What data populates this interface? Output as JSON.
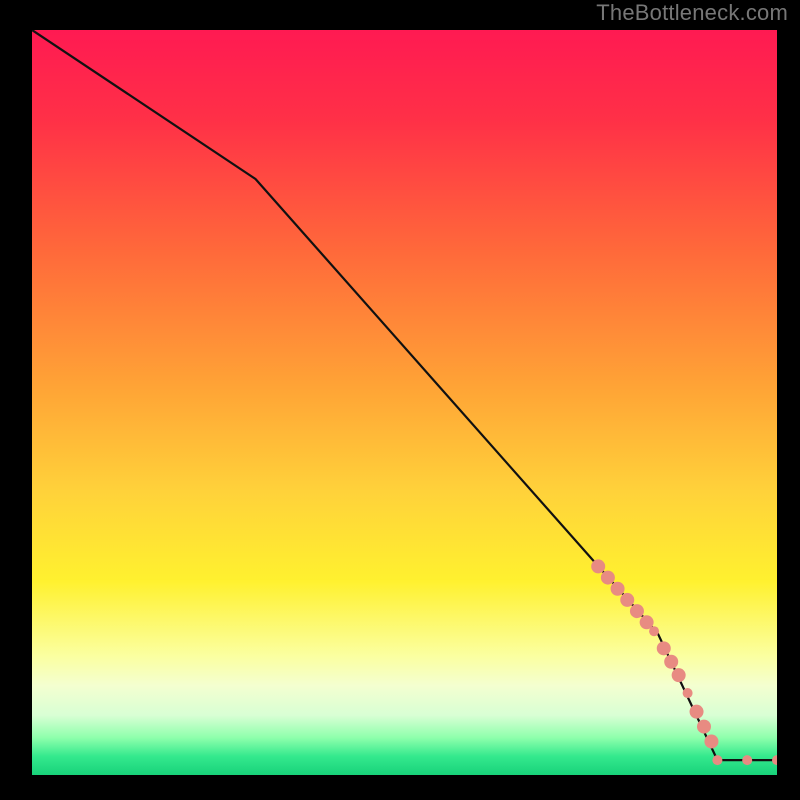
{
  "watermark": "TheBottleneck.com",
  "chart_data": {
    "type": "line",
    "title": "",
    "xlabel": "",
    "ylabel": "",
    "xlim": [
      0,
      100
    ],
    "ylim": [
      0,
      100
    ],
    "series": [
      {
        "name": "curve",
        "style": "line",
        "color": "#111111",
        "x": [
          0,
          30,
          84,
          92,
          100
        ],
        "y": [
          100,
          80,
          19,
          2,
          2
        ]
      },
      {
        "name": "markers",
        "style": "points",
        "color": "#e88b82",
        "radius_large": 7,
        "radius_small": 5,
        "points": [
          {
            "x": 76.0,
            "y": 28.0,
            "r": "large"
          },
          {
            "x": 77.3,
            "y": 26.5,
            "r": "large"
          },
          {
            "x": 78.6,
            "y": 25.0,
            "r": "large"
          },
          {
            "x": 79.9,
            "y": 23.5,
            "r": "large"
          },
          {
            "x": 81.2,
            "y": 22.0,
            "r": "large"
          },
          {
            "x": 82.5,
            "y": 20.5,
            "r": "large"
          },
          {
            "x": 83.5,
            "y": 19.3,
            "r": "small"
          },
          {
            "x": 84.8,
            "y": 17.0,
            "r": "large"
          },
          {
            "x": 85.8,
            "y": 15.2,
            "r": "large"
          },
          {
            "x": 86.8,
            "y": 13.4,
            "r": "large"
          },
          {
            "x": 88.0,
            "y": 11.0,
            "r": "small"
          },
          {
            "x": 89.2,
            "y": 8.5,
            "r": "large"
          },
          {
            "x": 90.2,
            "y": 6.5,
            "r": "large"
          },
          {
            "x": 91.2,
            "y": 4.5,
            "r": "large"
          },
          {
            "x": 92.0,
            "y": 2.0,
            "r": "small"
          },
          {
            "x": 96.0,
            "y": 2.0,
            "r": "small"
          },
          {
            "x": 100.0,
            "y": 2.0,
            "r": "small"
          }
        ]
      }
    ],
    "background_gradient": {
      "stops": [
        {
          "offset": 0.0,
          "color": "#ff1a52"
        },
        {
          "offset": 0.12,
          "color": "#ff3047"
        },
        {
          "offset": 0.3,
          "color": "#ff6a3a"
        },
        {
          "offset": 0.48,
          "color": "#ffa436"
        },
        {
          "offset": 0.62,
          "color": "#ffd23a"
        },
        {
          "offset": 0.74,
          "color": "#fff12f"
        },
        {
          "offset": 0.84,
          "color": "#fbffa0"
        },
        {
          "offset": 0.88,
          "color": "#f4ffd0"
        },
        {
          "offset": 0.92,
          "color": "#d8ffd4"
        },
        {
          "offset": 0.95,
          "color": "#8effac"
        },
        {
          "offset": 0.975,
          "color": "#34e98d"
        },
        {
          "offset": 1.0,
          "color": "#18d27a"
        }
      ]
    }
  }
}
